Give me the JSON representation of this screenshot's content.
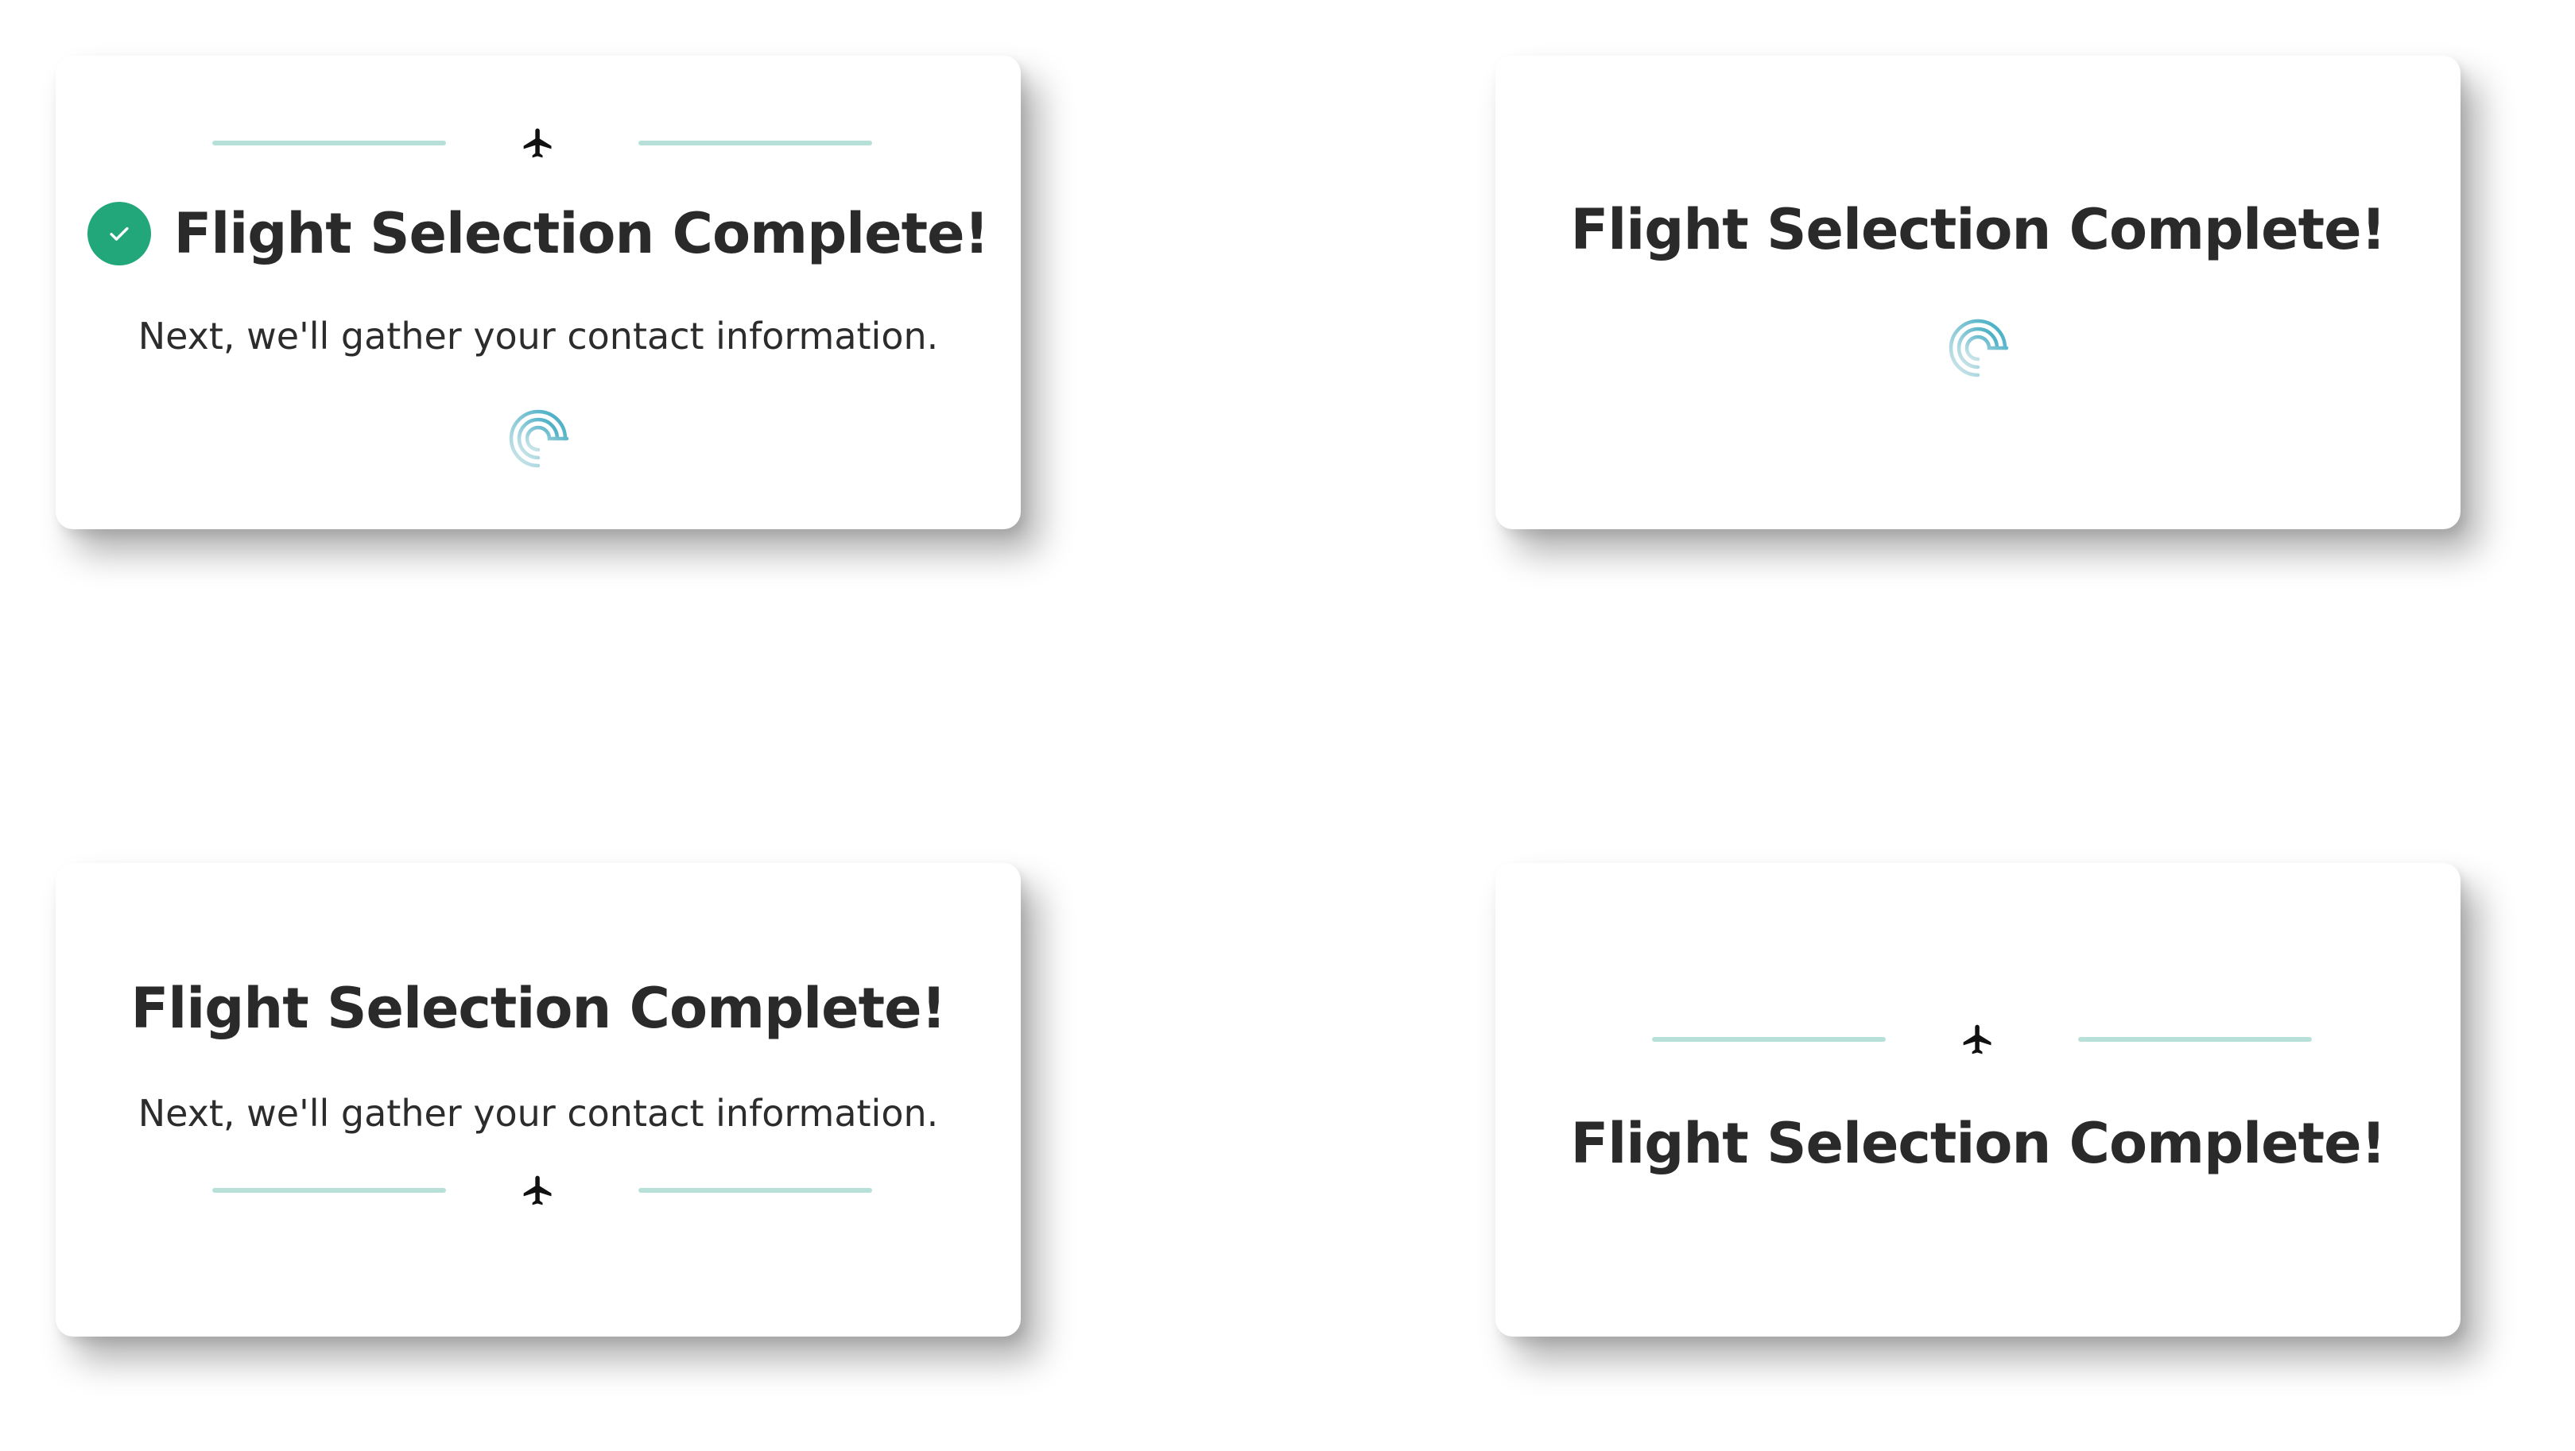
{
  "cards": [
    {
      "title": "Flight Selection Complete!",
      "subtitle": "Next, we'll gather your contact information.",
      "has_check": true,
      "has_divider": true,
      "has_spinner": true
    },
    {
      "title": "Flight Selection Complete!",
      "has_check": false,
      "has_divider": false,
      "has_spinner": true
    },
    {
      "title": "Flight Selection Complete!",
      "subtitle": "Next, we'll gather your contact information.",
      "has_check": false,
      "has_divider": true,
      "has_spinner": false
    },
    {
      "title": "Flight Selection Complete!",
      "has_check": false,
      "has_divider": true,
      "has_spinner": false
    }
  ],
  "icons": {
    "plane": "airplane-icon",
    "check": "check-icon",
    "spinner": "loading-spiral-icon"
  },
  "colors": {
    "background": "#ffffff",
    "card": "#ffffff",
    "title_text": "#2a2a2a",
    "body_text": "#2c2c2c",
    "divider_line": "#b7e1d8",
    "check_badge": "#22a77b",
    "spinner_light": "#cfe6ea",
    "spinner_accent": "#3aa8c1"
  }
}
